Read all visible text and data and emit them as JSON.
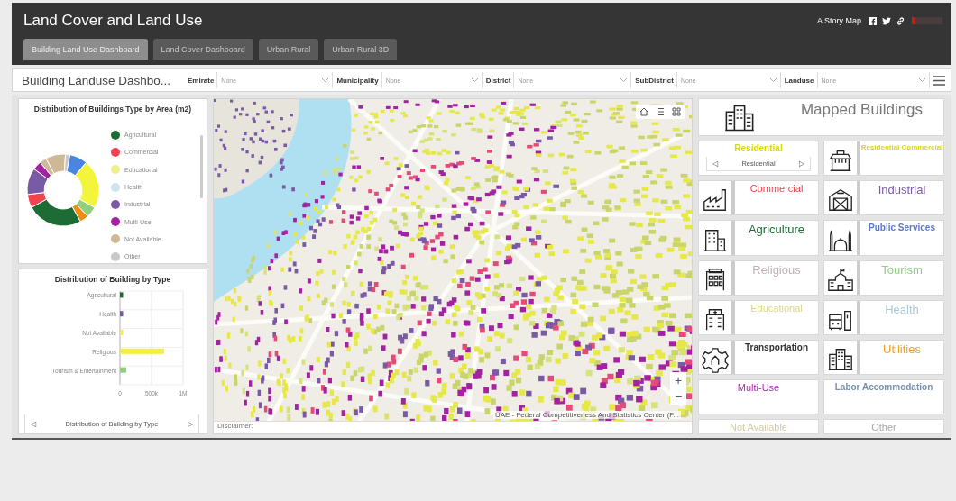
{
  "header": {
    "title": "Land Cover and Land Use",
    "story_map": "A Story Map"
  },
  "tabs": [
    {
      "label": "Building Land Use Dashboard",
      "selected": true
    },
    {
      "label": "Land Cover Dashboard",
      "selected": false
    },
    {
      "label": "Urban Rural",
      "selected": false
    },
    {
      "label": "Urban-Rural 3D",
      "selected": false
    }
  ],
  "filter_bar": {
    "title": "Building Landuse Dashbo...",
    "filters": [
      {
        "label": "Emirate",
        "value": "None"
      },
      {
        "label": "Municipality",
        "value": "None"
      },
      {
        "label": "District",
        "value": "None"
      },
      {
        "label": "SubDistrict",
        "value": "None"
      },
      {
        "label": "Landuse",
        "value": "None"
      }
    ]
  },
  "donut_panel": {
    "title": "Distribution of Buildings Type by Area (m2)",
    "legend": [
      {
        "label": "Agricultural",
        "color": "#1d6b35"
      },
      {
        "label": "Commercial",
        "color": "#f2434f"
      },
      {
        "label": "Educational",
        "color": "#eef08c"
      },
      {
        "label": "Health",
        "color": "#cfe4ea"
      },
      {
        "label": "Industrial",
        "color": "#7a5aa4"
      },
      {
        "label": "Multi-Use",
        "color": "#a422a2"
      },
      {
        "label": "Not Available",
        "color": "#cdb897"
      },
      {
        "label": "Other",
        "color": "#c9c9c9"
      }
    ]
  },
  "bar_panel": {
    "title": "Distribution of Building by Type",
    "footer": "Distribution of Building by Type",
    "prev": "◁",
    "next": "▷",
    "chart_data": {
      "type": "bar",
      "orientation": "horizontal",
      "categories": [
        "Agricultural",
        "Health",
        "Not Available",
        "Religious",
        "Tourism & Entertainment"
      ],
      "series": [
        {
          "color": "#1d6b35",
          "values": [
            50000,
            null,
            null,
            null,
            null
          ]
        },
        {
          "color": "#7a5aa4",
          "values": [
            null,
            50000,
            null,
            null,
            null
          ]
        },
        {
          "color": "#f2f03a",
          "values": [
            null,
            null,
            50000,
            700000,
            null
          ]
        },
        {
          "color": "#8fcf7e",
          "values": [
            null,
            null,
            null,
            null,
            100000
          ]
        }
      ],
      "xlim": [
        0,
        1000000
      ],
      "xticks": [
        {
          "value": 0,
          "label": "0"
        },
        {
          "value": 500000,
          "label": "500k"
        },
        {
          "value": 1000000,
          "label": "1M"
        }
      ]
    }
  },
  "map": {
    "attribution": "UAE - Federal Competitiveness And Statistics Center (F...",
    "disclaimer": "Disclaimer:",
    "zoom_in": "+",
    "zoom_out": "−"
  },
  "tiles": [
    {
      "kind": "header",
      "label": "Mapped Buildings",
      "color": "#777777"
    },
    {
      "kind": "carousel",
      "label": "Residential",
      "color": "#d8d810",
      "footer": "Residential",
      "prev": "◁",
      "next": "▷"
    },
    {
      "kind": "icon",
      "label": "Residential Commercial",
      "color": "#d8d810"
    },
    {
      "kind": "icon",
      "label": "Commercial",
      "color": "#f2434f"
    },
    {
      "kind": "icon",
      "label": "Industrial",
      "color": "#7a5aa4"
    },
    {
      "kind": "icon",
      "label": "Agriculture",
      "color": "#1d6b35"
    },
    {
      "kind": "icon",
      "label": "Public Services",
      "color": "#5a79c9"
    },
    {
      "kind": "icon",
      "label": "Religious",
      "color": "#c0b0b0"
    },
    {
      "kind": "icon",
      "label": "Tourism",
      "color": "#8fcf7e"
    },
    {
      "kind": "icon",
      "label": "Educational",
      "color": "#d8d890"
    },
    {
      "kind": "icon",
      "label": "Health",
      "color": "#a8cad8"
    },
    {
      "kind": "icon",
      "label": "Transportation",
      "color": "#333333"
    },
    {
      "kind": "icon",
      "label": "Utilities",
      "color": "#f0a020"
    },
    {
      "kind": "text",
      "label": "Multi-Use",
      "color": "#b02cb0"
    },
    {
      "kind": "text",
      "label": "Labor Accommodation",
      "color": "#7a92ac"
    },
    {
      "kind": "text",
      "label": "Not Available",
      "color": "#d8c8a8"
    },
    {
      "kind": "text",
      "label": "Other",
      "color": "#a8a8a8"
    }
  ]
}
